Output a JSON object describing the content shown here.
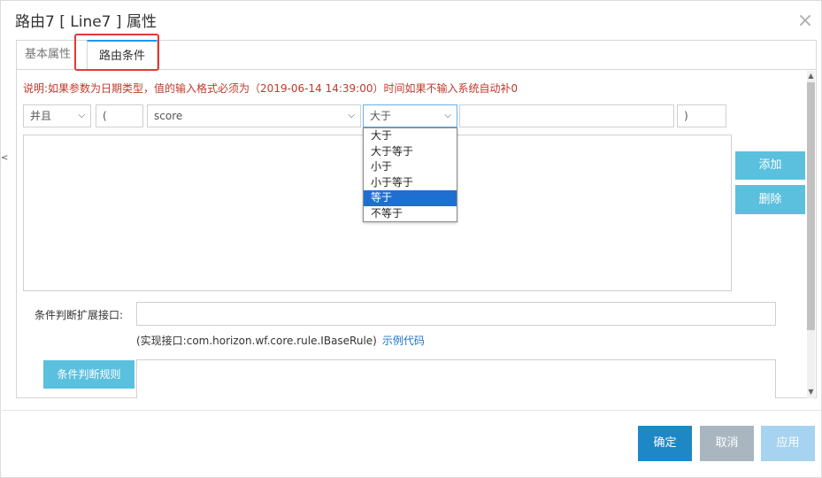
{
  "dialog": {
    "title": "路由7 [ Line7 ] 属性",
    "close_symbol": "×",
    "left_edge_mark": "<"
  },
  "tabs": [
    {
      "label": "基本属性"
    },
    {
      "label": "路由条件"
    }
  ],
  "note": "说明:如果参数为日期类型，值的输入格式必须为（2019-06-14 14:39:00）时间如果不输入系统自动补0",
  "condition_row": {
    "logic": "并且",
    "left_paren": "(",
    "field": "score",
    "operator": "大于",
    "value": "",
    "right_paren": ")"
  },
  "operator_options": [
    "大于",
    "大于等于",
    "小于",
    "小于等于",
    "等于",
    "不等于"
  ],
  "highlighted_option": "等于",
  "buttons": {
    "add": "添加",
    "delete": "删除",
    "rule": "条件判断规则",
    "ok": "确定",
    "cancel": "取消",
    "apply": "应用"
  },
  "extension": {
    "label": "条件判断扩展接口:",
    "value": "",
    "impl_note": "(实现接口:com.horizon.wf.core.rule.IBaseRule)",
    "example_link": "示例代码"
  },
  "colors": {
    "accent": "#1e88c7",
    "info_button": "#5bc0de",
    "note_red": "#c0392b",
    "highlight_box": "#e53935",
    "dropdown_selected": "#1f6fd1"
  },
  "icons": {
    "close": "close-icon",
    "chevron": "chevron-down-icon"
  }
}
